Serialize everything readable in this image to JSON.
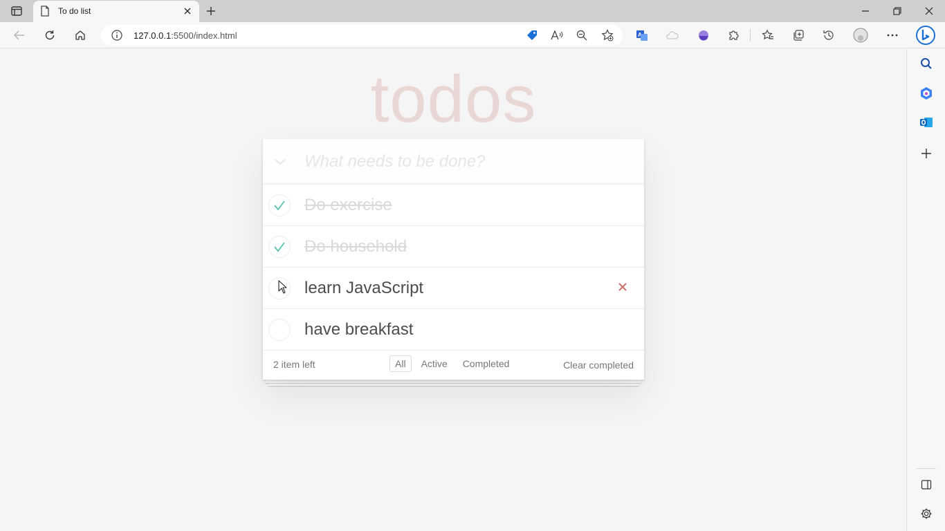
{
  "browser": {
    "tab_title": "To do list",
    "url_host": "127.0.0.1",
    "url_rest": ":5500/index.html"
  },
  "app": {
    "heading": "todos",
    "new_todo_placeholder": "What needs to be done?",
    "items": [
      {
        "label": "Do exercise",
        "completed": true
      },
      {
        "label": "Do household",
        "completed": true
      },
      {
        "label": "learn JavaScript",
        "completed": false
      },
      {
        "label": "have breakfast",
        "completed": false
      }
    ],
    "footer": {
      "count_text": "2 item left",
      "filters": [
        "All",
        "Active",
        "Completed"
      ],
      "selected_filter": "All",
      "clear_label": "Clear completed"
    }
  },
  "colors": {
    "heading": "#e9d7d6",
    "check": "#5dc2af",
    "destroy": "#c9706b",
    "bing": "#1a6fd6"
  }
}
